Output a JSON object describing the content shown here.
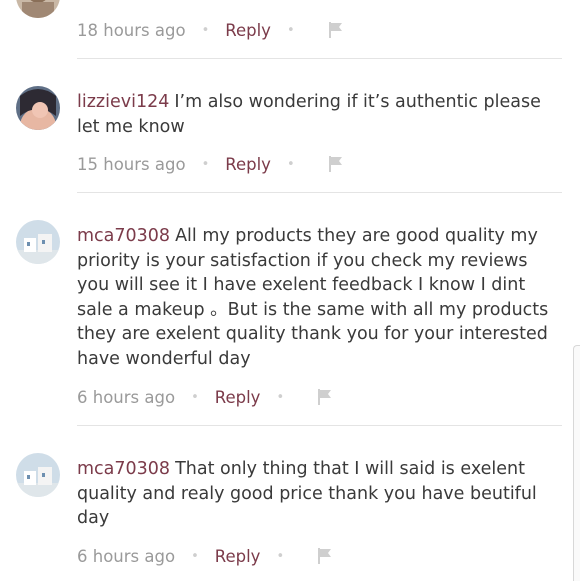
{
  "comments": [
    {
      "username": "",
      "text": "",
      "time": "18 hours ago",
      "reply_label": "Reply"
    },
    {
      "username": "lizzievi124",
      "text": "I’m also wondering if it’s authentic please let me know",
      "time": "15 hours ago",
      "reply_label": "Reply"
    },
    {
      "username": "mca70308",
      "text": "All my products  they are good quality my priority  is your satisfaction if you check my reviews you will see it I have exelent  feedback I know I dint sale a makeup  。But is the same with  all my products  they are  exelent quality thank you  for your interested  have wonderful day",
      "time": "6 hours ago",
      "reply_label": "Reply"
    },
    {
      "username": "mca70308",
      "text": "That only thing that I will said is exelent quality  and realy good price thank you  have beutiful day",
      "time": "6 hours ago",
      "reply_label": "Reply"
    }
  ],
  "icons": {
    "flag": "flag-icon",
    "separator": "dot"
  },
  "colors": {
    "username": "#7b3b4a",
    "reply": "#7b3b4a",
    "timestamp": "#9a9a9a",
    "divider": "#e4e4e4"
  }
}
